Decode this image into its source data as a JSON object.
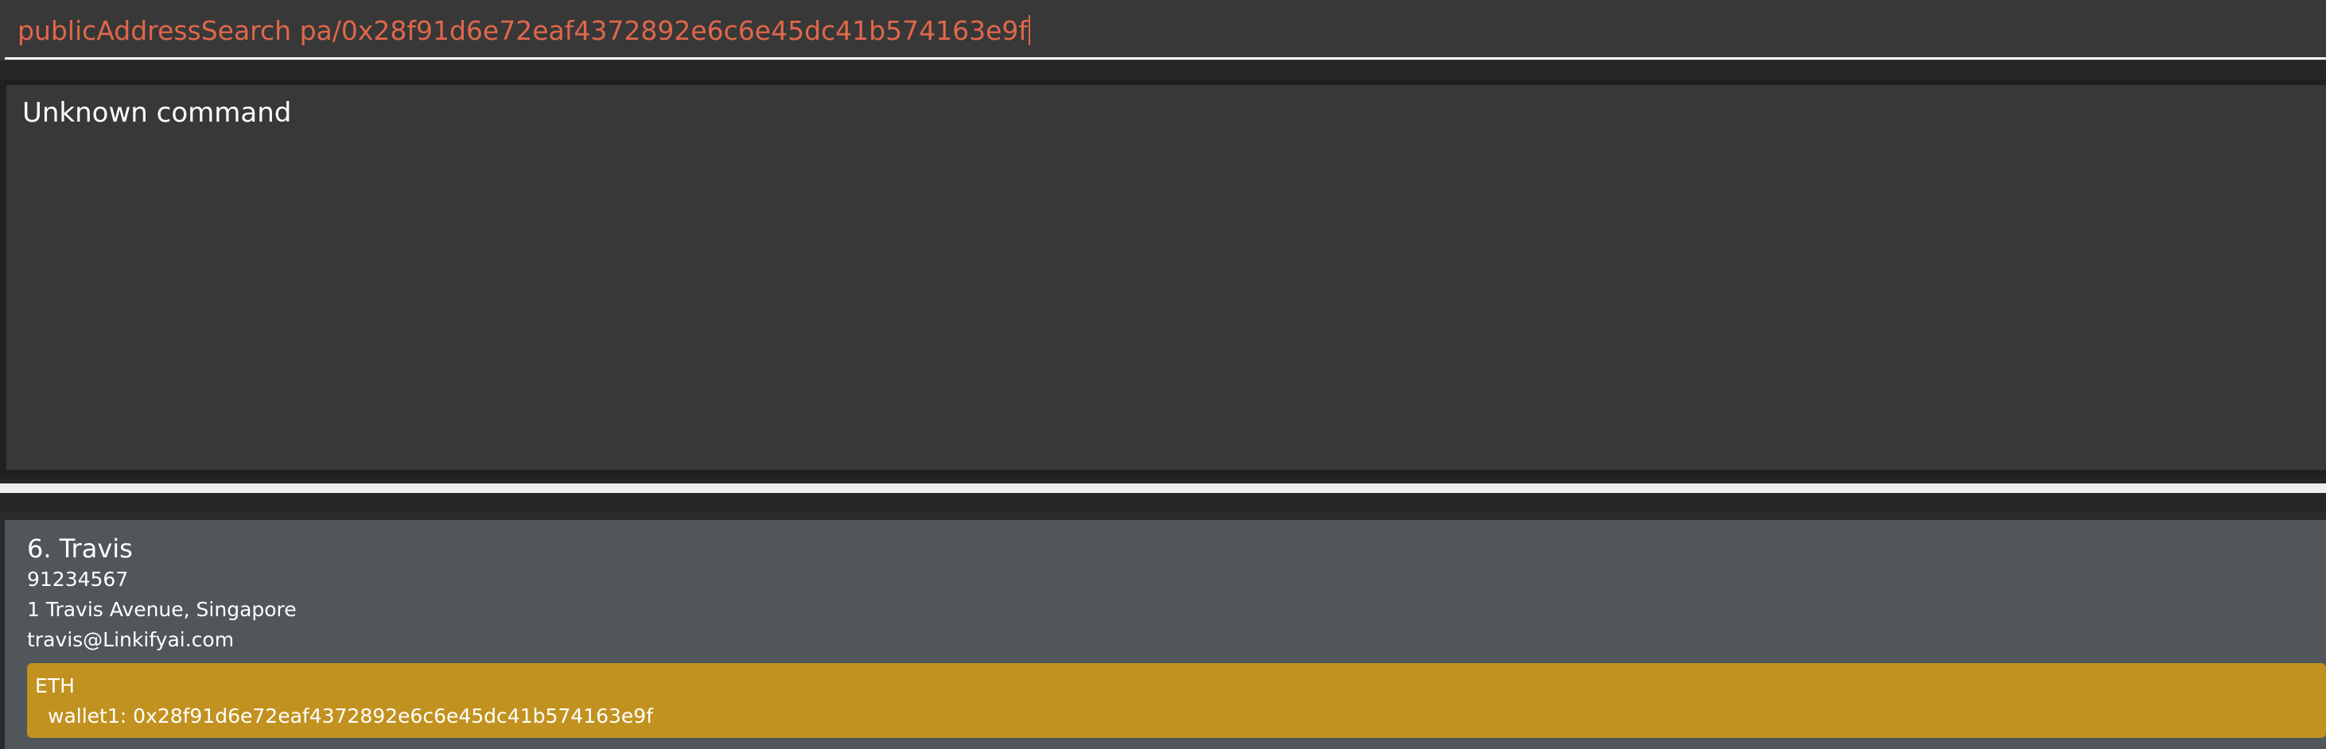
{
  "command_box": {
    "text": "publicAddressSearch pa/0x28f91d6e72eaf4372892e6c6e45dc41b574163e9f"
  },
  "result_display": {
    "text": "Unknown command"
  },
  "person_list": {
    "items": [
      {
        "index_name": "6. Travis",
        "phone": "91234567",
        "address": "1 Travis Avenue, Singapore",
        "email": "travis@Linkifyai.com",
        "wallet": {
          "network": "ETH",
          "label": "wallet1: 0x28f91d6e72eaf4372892e6c6e45dc41b574163e9f"
        }
      }
    ]
  },
  "colors": {
    "command_text": "#e0674a",
    "card_background": "#51565a",
    "wallet_tag": "#c29220"
  }
}
